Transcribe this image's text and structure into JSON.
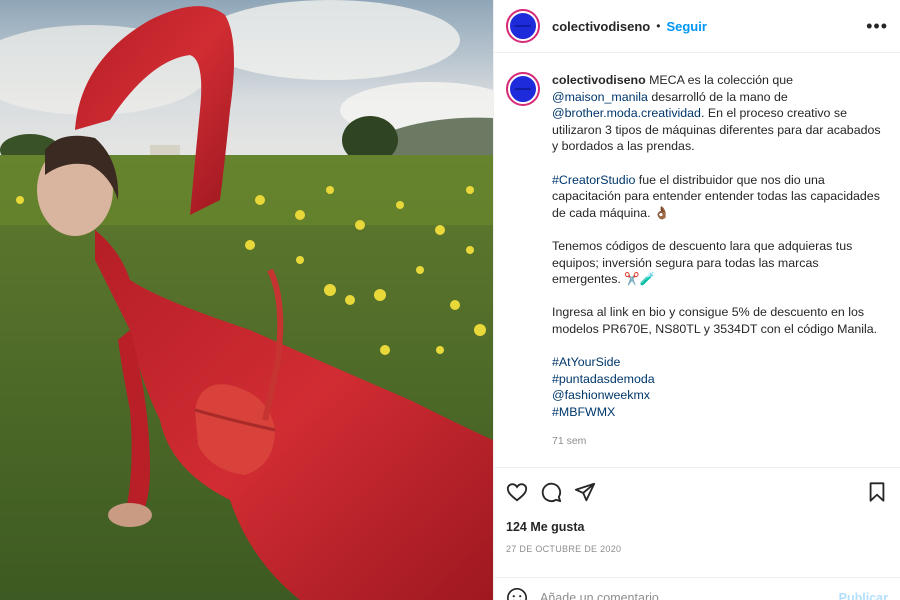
{
  "post": {
    "username": "colectivodiseno",
    "dot": "•",
    "follow_label": "Seguir",
    "more_label": "•••",
    "caption": {
      "username": "colectivodiseno",
      "p1_a": " MECA es la colección que ",
      "p1_mention1": "@maison_manila",
      "p1_b": " desarrolló de la mano de ",
      "p1_mention2": "@brother.moda.creatividad",
      "p1_c": ". En el proceso creativo se utilizaron 3 tipos de máquinas diferentes para dar acabados y bordados a las prendas.",
      "p2_tag": "#CreatorStudio",
      "p2_text": " fue el distribuidor que nos dio una capacitación para entender entender todas las capacidades de cada máquina. 👌🏾",
      "p3": "Tenemos códigos de descuento lara que adquieras tus equipos; inversión segura para todas las marcas emergentes. ✂️🧪",
      "p4": "Ingresa al link en bio y consigue 5% de descuento en los modelos PR670E, NS80TL y 3534DT con el código Manila.",
      "hashtags": [
        "#AtYourSide",
        "#puntadasdemoda",
        "@fashionweekmx",
        "#MBFWMX"
      ],
      "time": "71 sem"
    },
    "likes": "124 Me gusta",
    "date": "27 DE OCTUBRE DE 2020",
    "comment_placeholder": "Añade un comentario...",
    "publish_label": "Publicar"
  },
  "icons": {
    "like": "heart-icon",
    "comment": "comment-icon",
    "share": "share-icon",
    "save": "bookmark-icon",
    "emoji": "emoji-icon",
    "more": "more-icon"
  },
  "colors": {
    "accent": "#0095f6",
    "link": "#00376b",
    "muted": "#8e8e8e",
    "publish_disabled": "#b2dffc",
    "avatar_blue": "#1d2bdb",
    "dress_red": "#c8242b"
  }
}
